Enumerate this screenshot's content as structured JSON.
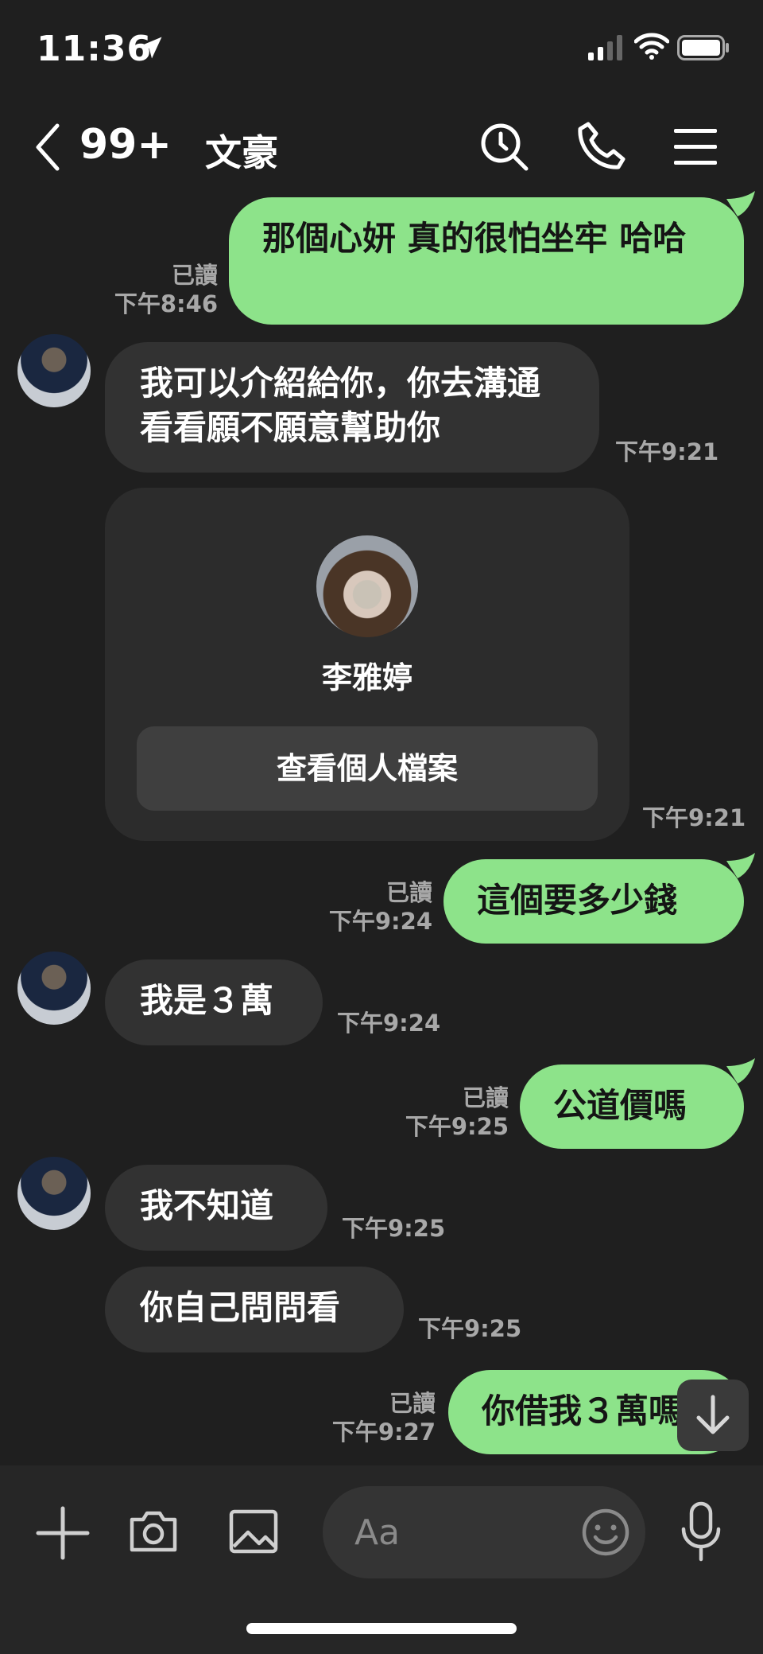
{
  "status_bar": {
    "time": "11:36"
  },
  "header": {
    "unread_count": "99+",
    "chat_name": "文豪"
  },
  "messages": [
    {
      "dir": "out",
      "text": "那個心妍 真的很怕坐牢 哈哈",
      "read": "已讀",
      "time": "下午8:46"
    },
    {
      "dir": "in",
      "text": "我可以介紹給你，你去溝通看看願不願意幫助你",
      "time": "下午9:21"
    },
    {
      "dir": "in",
      "type": "contact",
      "name": "李雅婷",
      "button": "查看個人檔案",
      "time": "下午9:21"
    },
    {
      "dir": "out",
      "text": "這個要多少錢",
      "read": "已讀",
      "time": "下午9:24"
    },
    {
      "dir": "in",
      "text": "我是３萬",
      "time": "下午9:24"
    },
    {
      "dir": "out",
      "text": "公道價嗎",
      "read": "已讀",
      "time": "下午9:25"
    },
    {
      "dir": "in",
      "text": "我不知道",
      "time": "下午9:25"
    },
    {
      "dir": "in",
      "text": "你自己問問看",
      "time": "下午9:25"
    },
    {
      "dir": "out",
      "text": "你借我３萬嗎",
      "read": "已讀",
      "time": "下午9:27"
    }
  ],
  "input": {
    "placeholder": "Aa"
  },
  "colors": {
    "outgoing_bubble": "#8de38a",
    "incoming_bubble": "#323232",
    "background": "#1f1f1f"
  }
}
